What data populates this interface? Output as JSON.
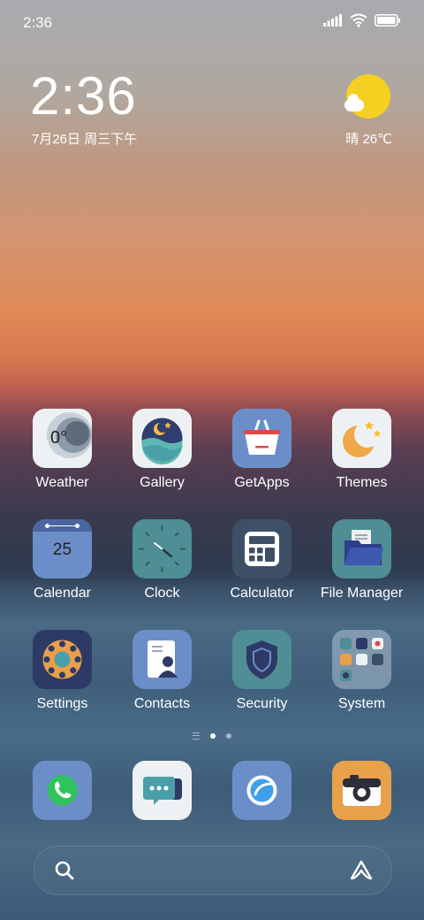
{
  "status_bar": {
    "time": "2:36",
    "icons": [
      "signal-icon",
      "wifi-icon",
      "battery-icon"
    ]
  },
  "clock_widget": {
    "time": "2:36",
    "date": "7月26日 周三下午"
  },
  "weather_widget": {
    "icon": "sun-cloud-icon",
    "text": "晴 26℃"
  },
  "apps": [
    {
      "label": "Weather",
      "icon": "weather-icon"
    },
    {
      "label": "Gallery",
      "icon": "gallery-icon"
    },
    {
      "label": "GetApps",
      "icon": "getapps-icon"
    },
    {
      "label": "Themes",
      "icon": "themes-icon"
    },
    {
      "label": "Calendar",
      "icon": "calendar-icon",
      "icon_text": "25"
    },
    {
      "label": "Clock",
      "icon": "clock-icon"
    },
    {
      "label": "Calculator",
      "icon": "calculator-icon"
    },
    {
      "label": "File Manager",
      "icon": "file-manager-icon"
    },
    {
      "label": "Settings",
      "icon": "settings-icon"
    },
    {
      "label": "Contacts",
      "icon": "contacts-icon"
    },
    {
      "label": "Security",
      "icon": "security-icon"
    },
    {
      "label": "System",
      "icon": "system-folder-icon"
    }
  ],
  "weather_icon_text": "0°",
  "page_indicator": {
    "pages": 3,
    "current": 1
  },
  "dock": [
    {
      "icon": "phone-icon"
    },
    {
      "icon": "messages-icon"
    },
    {
      "icon": "browser-icon"
    },
    {
      "icon": "camera-icon"
    }
  ],
  "search_bar": {
    "left_icon": "search-icon",
    "right_icon": "assistant-icon"
  }
}
